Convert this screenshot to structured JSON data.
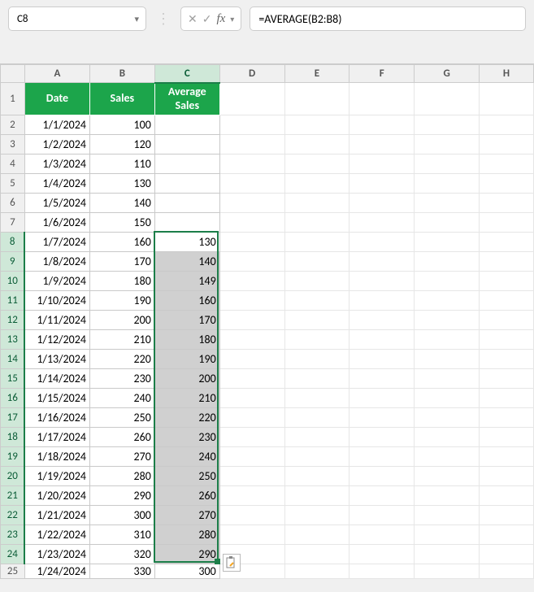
{
  "formula_bar": {
    "name_box": "C8",
    "formula": "=AVERAGE(B2:B8)"
  },
  "columns": [
    "A",
    "B",
    "C",
    "D",
    "E",
    "F",
    "G",
    "H"
  ],
  "headers": {
    "A": "Date",
    "B": "Sales",
    "C": "Average Sales"
  },
  "rows": [
    {
      "n": "1"
    },
    {
      "n": "2",
      "date": "1/1/2024",
      "sales": "100",
      "avg": ""
    },
    {
      "n": "3",
      "date": "1/2/2024",
      "sales": "120",
      "avg": ""
    },
    {
      "n": "4",
      "date": "1/3/2024",
      "sales": "110",
      "avg": ""
    },
    {
      "n": "5",
      "date": "1/4/2024",
      "sales": "130",
      "avg": ""
    },
    {
      "n": "6",
      "date": "1/5/2024",
      "sales": "140",
      "avg": ""
    },
    {
      "n": "7",
      "date": "1/6/2024",
      "sales": "150",
      "avg": ""
    },
    {
      "n": "8",
      "date": "1/7/2024",
      "sales": "160",
      "avg": "130"
    },
    {
      "n": "9",
      "date": "1/8/2024",
      "sales": "170",
      "avg": "140"
    },
    {
      "n": "10",
      "date": "1/9/2024",
      "sales": "180",
      "avg": "149"
    },
    {
      "n": "11",
      "date": "1/10/2024",
      "sales": "190",
      "avg": "160"
    },
    {
      "n": "12",
      "date": "1/11/2024",
      "sales": "200",
      "avg": "170"
    },
    {
      "n": "13",
      "date": "1/12/2024",
      "sales": "210",
      "avg": "180"
    },
    {
      "n": "14",
      "date": "1/13/2024",
      "sales": "220",
      "avg": "190"
    },
    {
      "n": "15",
      "date": "1/14/2024",
      "sales": "230",
      "avg": "200"
    },
    {
      "n": "16",
      "date": "1/15/2024",
      "sales": "240",
      "avg": "210"
    },
    {
      "n": "17",
      "date": "1/16/2024",
      "sales": "250",
      "avg": "220"
    },
    {
      "n": "18",
      "date": "1/17/2024",
      "sales": "260",
      "avg": "230"
    },
    {
      "n": "19",
      "date": "1/18/2024",
      "sales": "270",
      "avg": "240"
    },
    {
      "n": "20",
      "date": "1/19/2024",
      "sales": "280",
      "avg": "250"
    },
    {
      "n": "21",
      "date": "1/20/2024",
      "sales": "290",
      "avg": "260"
    },
    {
      "n": "22",
      "date": "1/21/2024",
      "sales": "300",
      "avg": "270"
    },
    {
      "n": "23",
      "date": "1/22/2024",
      "sales": "310",
      "avg": "280"
    },
    {
      "n": "24",
      "date": "1/23/2024",
      "sales": "320",
      "avg": "290"
    },
    {
      "n": "25",
      "date": "1/24/2024",
      "sales": "330",
      "avg": "300"
    }
  ],
  "chart_data": {
    "type": "table",
    "title": "Spreadsheet with 7-day moving average",
    "columns": [
      "Date",
      "Sales",
      "Average Sales"
    ],
    "data": [
      [
        "1/1/2024",
        100,
        null
      ],
      [
        "1/2/2024",
        120,
        null
      ],
      [
        "1/3/2024",
        110,
        null
      ],
      [
        "1/4/2024",
        130,
        null
      ],
      [
        "1/5/2024",
        140,
        null
      ],
      [
        "1/6/2024",
        150,
        null
      ],
      [
        "1/7/2024",
        160,
        130
      ],
      [
        "1/8/2024",
        170,
        140
      ],
      [
        "1/9/2024",
        180,
        149
      ],
      [
        "1/10/2024",
        190,
        160
      ],
      [
        "1/11/2024",
        200,
        170
      ],
      [
        "1/12/2024",
        210,
        180
      ],
      [
        "1/13/2024",
        220,
        190
      ],
      [
        "1/14/2024",
        230,
        200
      ],
      [
        "1/15/2024",
        240,
        210
      ],
      [
        "1/16/2024",
        250,
        220
      ],
      [
        "1/17/2024",
        260,
        230
      ],
      [
        "1/18/2024",
        270,
        240
      ],
      [
        "1/19/2024",
        280,
        250
      ],
      [
        "1/20/2024",
        290,
        260
      ],
      [
        "1/21/2024",
        300,
        270
      ],
      [
        "1/22/2024",
        310,
        280
      ],
      [
        "1/23/2024",
        320,
        290
      ],
      [
        "1/24/2024",
        330,
        300
      ]
    ]
  }
}
